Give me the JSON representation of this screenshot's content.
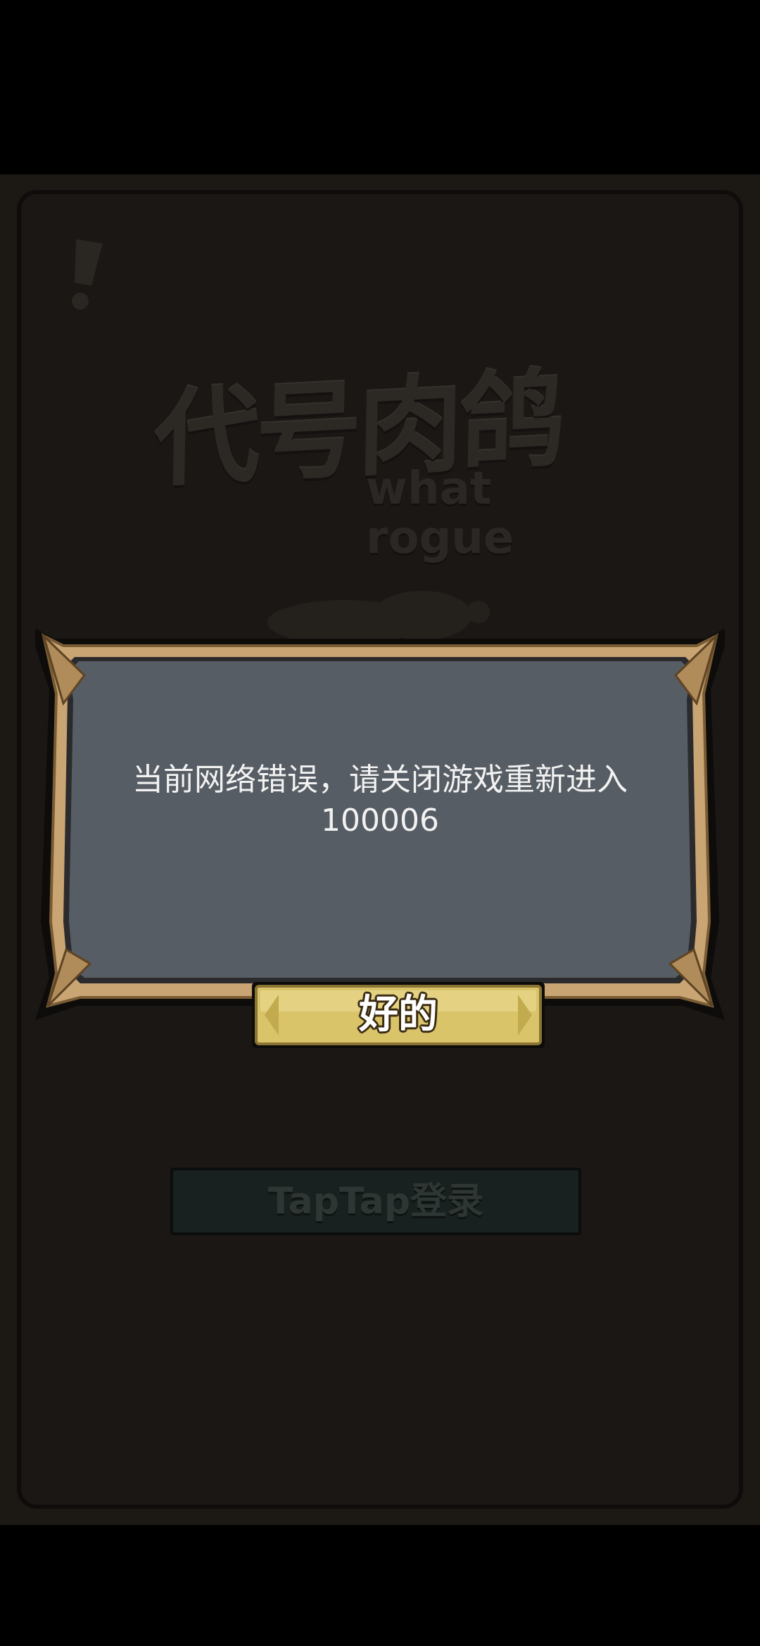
{
  "game": {
    "logo_cn": "代号肉鸽",
    "logo_en": "what rogue",
    "login_button_label": "TapTap登录"
  },
  "dialog": {
    "message": "当前网络错误，请关闭游戏重新进入\n100006",
    "ok_label": "好的"
  },
  "colors": {
    "dialog_fill": "#575d64",
    "dialog_frame": "#c9a574",
    "button_gold": "#d9c46a",
    "background": "#1a1714"
  }
}
